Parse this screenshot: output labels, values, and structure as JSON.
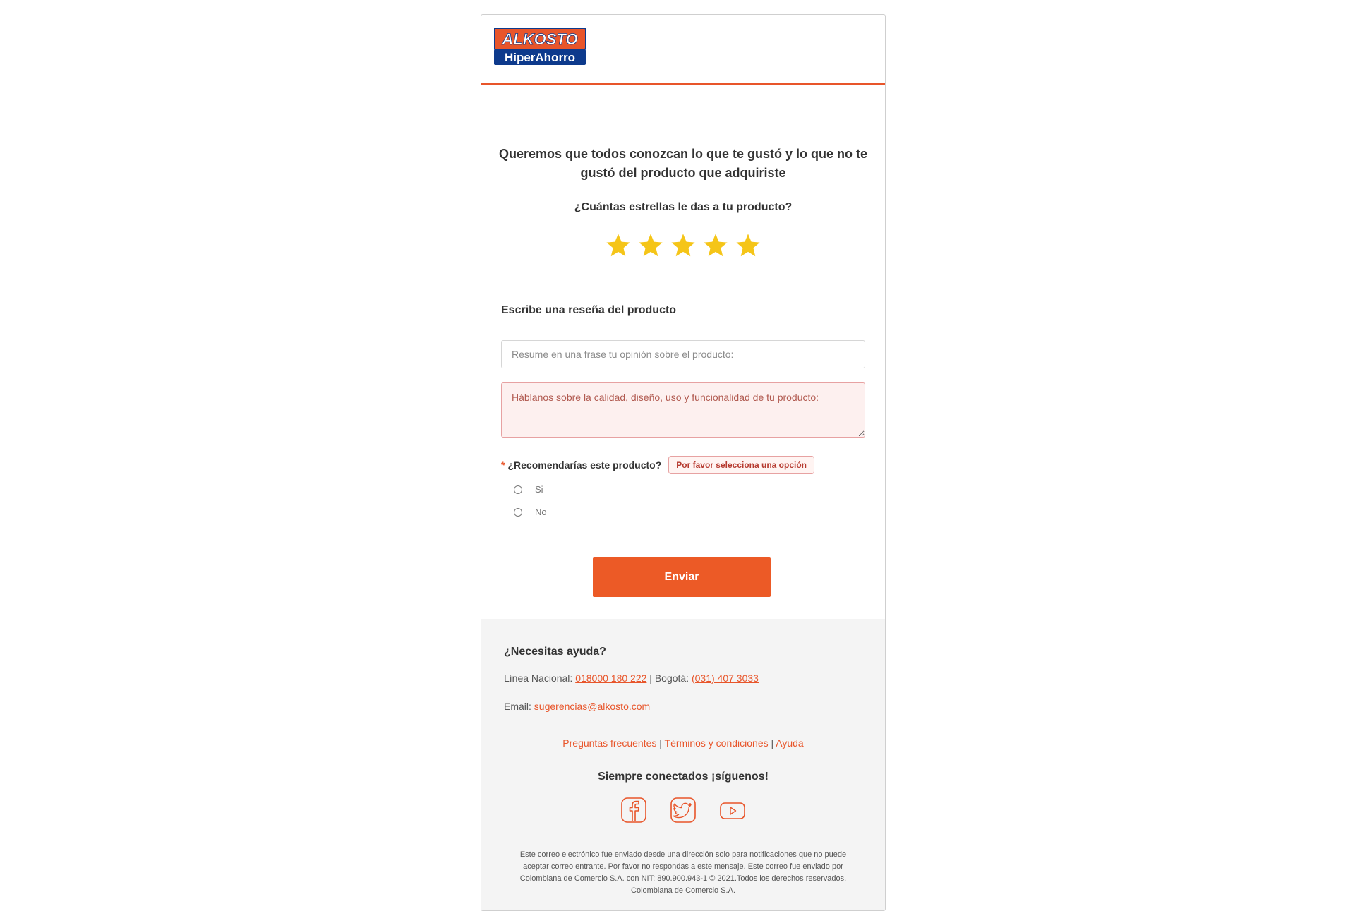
{
  "brand": {
    "logo_top": "ALKOSTO",
    "logo_bottom": "HiperAhorro",
    "accent_color": "#e8552a",
    "blue_color": "#0d3a8c"
  },
  "review": {
    "headline": "Queremos que todos conozcan lo que te gustó y lo que no te gustó del producto que adquiriste",
    "stars_question": "¿Cuántas estrellas le das a tu producto?",
    "stars_selected": 5,
    "stars_total": 5,
    "star_color": "#f5c518",
    "review_label": "Escribe una reseña del producto",
    "summary_placeholder": "Resume en una frase tu opinión sobre el producto:",
    "summary_value": "",
    "detail_placeholder": "Háblanos sobre la calidad, diseño, uso y funcionalidad de tu producto:",
    "detail_value": "",
    "required_mark": "*",
    "recommend_label": "¿Recomendarías este producto?",
    "recommend_error": "Por favor selecciona una opción",
    "options": [
      "Si",
      "No"
    ],
    "submit_label": "Enviar"
  },
  "footer": {
    "help_title": "¿Necesitas ayuda?",
    "national_label": "Línea Nacional:",
    "national_phone": "018000 180 222",
    "separator": "|",
    "bogota_label": "Bogotá:",
    "bogota_phone": "(031) 407 3033",
    "email_label": "Email:",
    "email": "sugerencias@alkosto.com",
    "links": [
      "Preguntas frecuentes",
      "Términos y condiciones",
      "Ayuda"
    ],
    "social_title": "Siempre conectados ¡síguenos!",
    "social_icons": [
      "facebook-icon",
      "twitter-icon",
      "youtube-icon"
    ],
    "disclaimer": "Este correo electrónico fue enviado desde una dirección solo para notificaciones que no puede aceptar correo entrante. Por favor no respondas a este mensaje. Este correo fue enviado por Colombiana de Comercio S.A. con NIT: 890.900.943-1 © 2021.Todos los derechos reservados. Colombiana de Comercio S.A."
  }
}
